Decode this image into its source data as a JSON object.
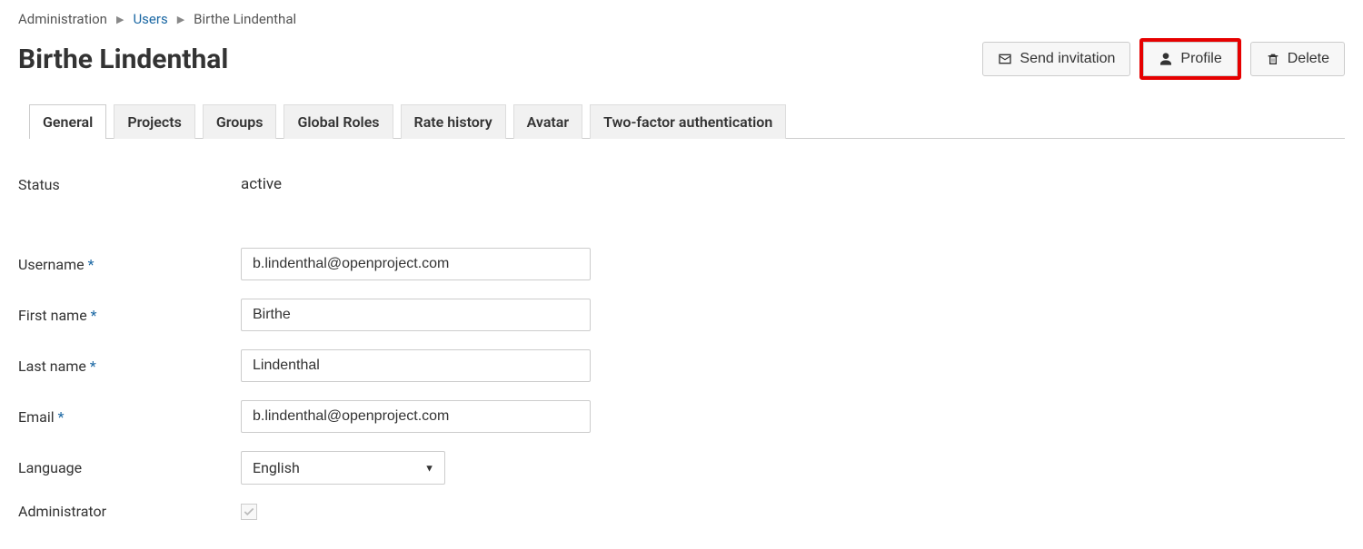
{
  "breadcrumb": {
    "root": "Administration",
    "section": "Users",
    "current": "Birthe Lindenthal"
  },
  "page_title": "Birthe Lindenthal",
  "actions": {
    "send_invitation": "Send invitation",
    "profile": "Profile",
    "delete": "Delete"
  },
  "tabs": [
    {
      "label": "General",
      "active": true
    },
    {
      "label": "Projects",
      "active": false
    },
    {
      "label": "Groups",
      "active": false
    },
    {
      "label": "Global Roles",
      "active": false
    },
    {
      "label": "Rate history",
      "active": false
    },
    {
      "label": "Avatar",
      "active": false
    },
    {
      "label": "Two-factor authentication",
      "active": false
    }
  ],
  "form": {
    "status_label": "Status",
    "status_value": "active",
    "username_label": "Username",
    "username_value": "b.lindenthal@openproject.com",
    "firstname_label": "First name",
    "firstname_value": "Birthe",
    "lastname_label": "Last name",
    "lastname_value": "Lindenthal",
    "email_label": "Email",
    "email_value": "b.lindenthal@openproject.com",
    "language_label": "Language",
    "language_value": "English",
    "admin_label": "Administrator",
    "admin_checked": true
  }
}
